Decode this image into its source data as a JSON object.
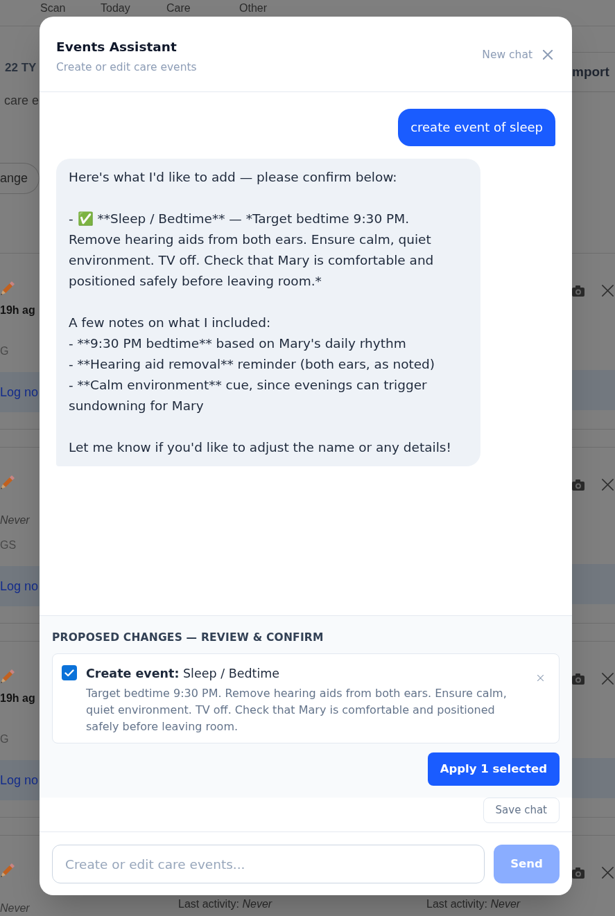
{
  "backdrop": {
    "nav_tabs": [
      {
        "label": "Scan"
      },
      {
        "label": "Today"
      },
      {
        "label": "Care"
      },
      {
        "label": "Other"
      }
    ],
    "heading": "22 TY",
    "subtitle": "care e",
    "option_button": "ange",
    "header_button": "mport",
    "card_rows": [
      {
        "kind": "recent",
        "activity": "19h ag",
        "tag": "G",
        "action": "Log no"
      },
      {
        "kind": "never",
        "activity": "Never",
        "tag": "GS",
        "action": "Log no"
      },
      {
        "kind": "recent",
        "activity": "19h ag",
        "tag": "G",
        "action": "Log no"
      },
      {
        "kind": "never",
        "activity": "Never"
      }
    ],
    "bottom_texts": [
      "Last activity: *Never*",
      "Last activity: *Never*"
    ]
  },
  "dialog": {
    "title": "Events Assistant",
    "subtitle": "Create or edit care events",
    "new_chat": "New chat",
    "messages": [
      {
        "kind": "user",
        "text": "create event of sleep"
      },
      {
        "kind": "assistant",
        "text": "Here's what I'd like to add — please confirm below:\n\n- ✅ **Sleep / Bedtime** — *Target bedtime 9:30 PM. Remove hearing aids from both ears. Ensure calm, quiet environment. TV off. Check that Mary is comfortable and positioned safely before leaving room.*\n\nA few notes on what I included:\n- **9:30 PM bedtime** based on Mary's daily rhythm\n- **Hearing aid removal** reminder (both ears, as noted)\n- **Calm environment** cue, since evenings can trigger sundowning for Mary\n\nLet me know if you'd like to adjust the name or any details!"
      }
    ],
    "proposed": {
      "heading": "PROPOSED CHANGES — REVIEW & CONFIRM",
      "items": [
        {
          "checked": true,
          "title": "**Create event:** Sleep / Bedtime",
          "description": "Target bedtime 9:30 PM. Remove hearing aids from both ears. Ensure calm, quiet environment. TV off. Check that Mary is comfortable and positioned safely before leaving room."
        }
      ],
      "apply_button": "Apply 1 selected"
    },
    "save_chat": "Save chat",
    "composer": {
      "placeholder": "Create or edit care events...",
      "send": {
        "label": "Send",
        "disabled": true
      }
    }
  }
}
